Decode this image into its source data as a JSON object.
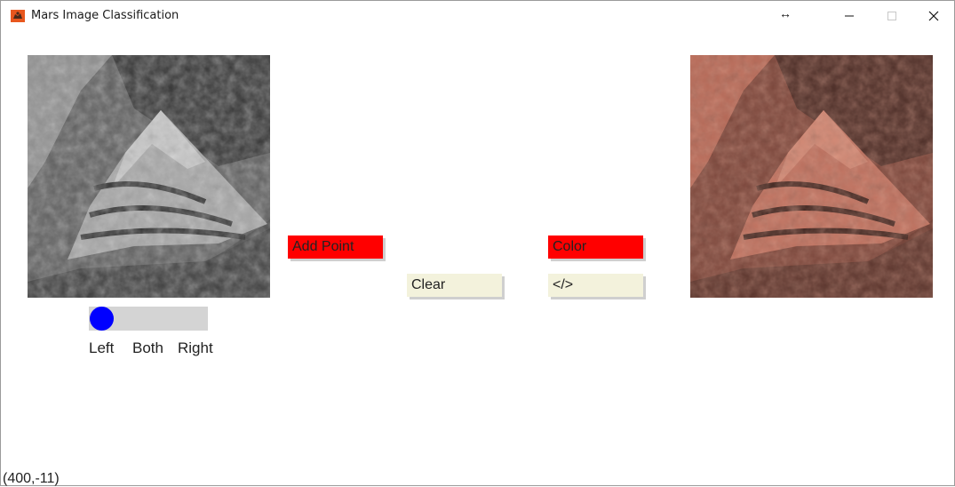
{
  "window": {
    "title": "Mars Image Classification",
    "icons": {
      "app": "mars-rover-app-icon",
      "resize": "horizontal-resize-cursor-icon",
      "minimize": "minimize-icon",
      "maximize": "maximize-icon",
      "close": "close-icon"
    },
    "resize_glyph": "↔"
  },
  "images": {
    "left": {
      "name": "grayscale-mars-rock-image",
      "tint": "grayscale"
    },
    "right": {
      "name": "colorized-mars-rock-image",
      "tint": "reddish"
    }
  },
  "slider": {
    "options": [
      "Left",
      "Both",
      "Right"
    ],
    "selected": "Left",
    "thumb_color": "#0000ff",
    "track_color": "#d4d4d4"
  },
  "buttons": {
    "add_point": {
      "label": "Add Point",
      "color": "#ff0000"
    },
    "clear": {
      "label": "Clear",
      "color": "#f3f2dc"
    },
    "color": {
      "label": "Color",
      "color": "#ff0000"
    },
    "code": {
      "label": "</>",
      "color": "#f3f2dc"
    }
  },
  "status": {
    "coordinates": "(400,-11)"
  }
}
